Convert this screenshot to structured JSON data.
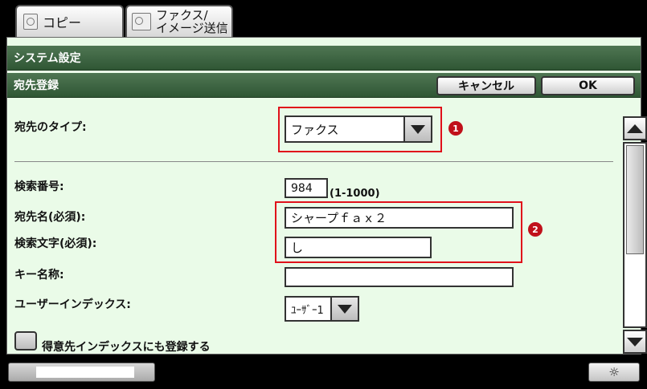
{
  "tabs": [
    {
      "label": "コピー",
      "icon": "copy-icon"
    },
    {
      "label_line1": "ファクス/",
      "label_line2": "イメージ送信",
      "icon": "fax-icon"
    }
  ],
  "header": {
    "system_title": "システム設定",
    "section_title": "宛先登録",
    "cancel_label": "キャンセル",
    "ok_label": "OK"
  },
  "form": {
    "dest_type_label": "宛先のタイプ:",
    "dest_type_value": "ファクス",
    "search_no_label": "検索番号:",
    "search_no_value": "984",
    "search_no_range": "(1-1000)",
    "dest_name_label": "宛先名(必須):",
    "dest_name_value": "シャープｆａｘ２",
    "search_char_label": "検索文字(必須):",
    "search_char_value": "し",
    "key_name_label": "キー名称:",
    "key_name_value": "",
    "user_index_label": "ユーザーインデックス:",
    "user_index_value": "ﾕｰｻﾞｰ1",
    "favorite_label": "得意先インデックスにも登録する"
  },
  "badges": [
    "1",
    "2"
  ],
  "colors": {
    "header_green": "#3c6442",
    "panel_bg": "#eafbe8",
    "highlight_red": "#e0101a",
    "badge_red": "#c0101a"
  },
  "bottom": {
    "brightness_icon": "sun-icon",
    "brightness_glyph": "☼"
  }
}
